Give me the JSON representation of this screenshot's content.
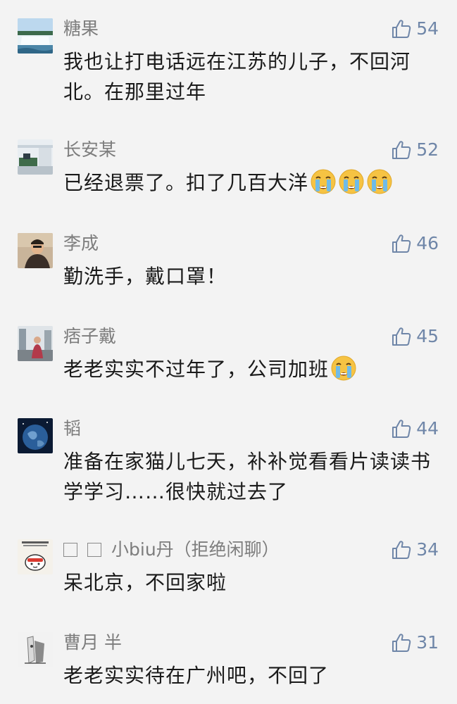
{
  "comments": [
    {
      "name": "糖果",
      "likes": "54",
      "text": "我也让打电话远在江苏的儿子，不回河北。在那里过年",
      "avatar": "waterfall-avatar"
    },
    {
      "name": "长安某",
      "likes": "52",
      "text": "已经退票了。扣了几百大洋",
      "emojis": [
        "crying-face-emoji",
        "crying-face-emoji",
        "crying-face-emoji"
      ],
      "avatar": "building-avatar"
    },
    {
      "name": "李成",
      "likes": "46",
      "text": "勤洗手，戴口罩！",
      "avatar": "person-avatar"
    },
    {
      "name": "痞子戴",
      "likes": "45",
      "text": "老老实实不过年了，公司加班",
      "emojis": [
        "crying-face-emoji"
      ],
      "avatar": "street-avatar"
    },
    {
      "name": "韬",
      "likes": "44",
      "text": "准备在家猫儿七天，补补觉看看片读读书学学习……很快就过去了",
      "avatar": "earth-avatar"
    },
    {
      "name": "小biu丹（拒绝闲聊）",
      "likes": "34",
      "text": "呆北京，不回家啦",
      "avatar": "cartoon-avatar"
    },
    {
      "name": "曹月 半",
      "likes": "31",
      "text": "老老实实待在广州吧，不回了",
      "avatar": "sketch-avatar"
    }
  ]
}
